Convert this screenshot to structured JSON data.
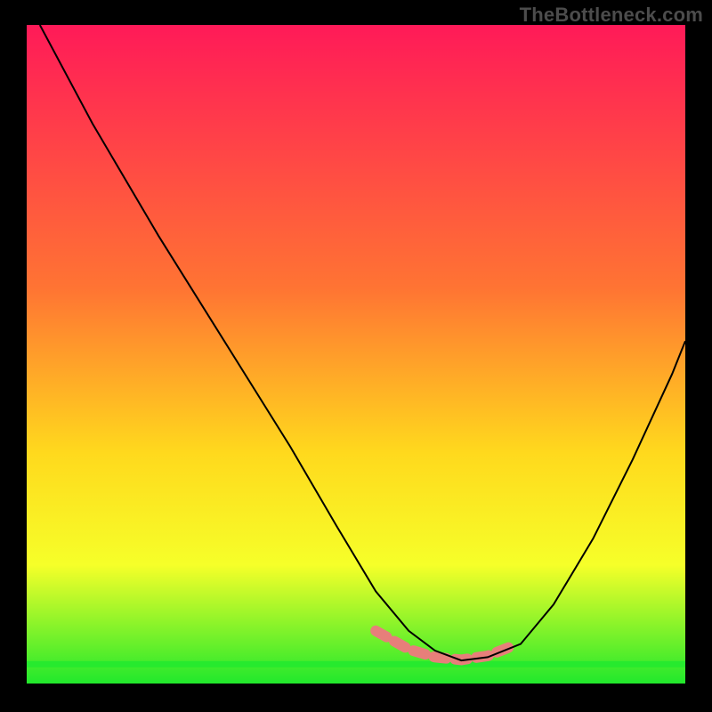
{
  "watermark": {
    "text": "TheBottleneck.com"
  },
  "palette": {
    "black": "#000000",
    "curve_stroke": "#000000",
    "band_pink": "#e77f7a",
    "band_green": "#26ea2e",
    "grad_top": "#ff1a58",
    "grad_mid1": "#ff7433",
    "grad_mid2": "#ffd91d",
    "grad_mid3": "#f6ff29",
    "grad_bottom": "#21e82c"
  },
  "chart_data": {
    "type": "line",
    "title": "",
    "xlabel": "",
    "ylabel": "",
    "xlim": [
      0,
      100
    ],
    "ylim": [
      0,
      100
    ],
    "grid": false,
    "legend": false,
    "description": "Single V-shaped bottleneck curve on a red→yellow→green vertical gradient. Lower y = better (green). Small pink dashed segment and thin green band sit along the valley floor near y≈3–4.",
    "gradient_stops": [
      {
        "offset": 0,
        "color": "#ff1a58"
      },
      {
        "offset": 40,
        "color": "#ff7433"
      },
      {
        "offset": 65,
        "color": "#ffd91d"
      },
      {
        "offset": 82,
        "color": "#f6ff29"
      },
      {
        "offset": 100,
        "color": "#21e82c"
      }
    ],
    "series": [
      {
        "name": "bottleneck-curve",
        "x": [
          2,
          10,
          20,
          30,
          40,
          47,
          53,
          58,
          62,
          66,
          70,
          75,
          80,
          86,
          92,
          98,
          100
        ],
        "y": [
          100,
          85,
          68,
          52,
          36,
          24,
          14,
          8,
          5,
          3.5,
          4,
          6,
          12,
          22,
          34,
          47,
          52
        ]
      }
    ],
    "valley_marker": {
      "name": "valley-pink-band",
      "x": [
        53,
        58,
        62,
        66,
        70,
        74
      ],
      "y": [
        8,
        5.2,
        4.0,
        3.6,
        4.2,
        5.8
      ]
    },
    "green_band_y": 3.0
  }
}
